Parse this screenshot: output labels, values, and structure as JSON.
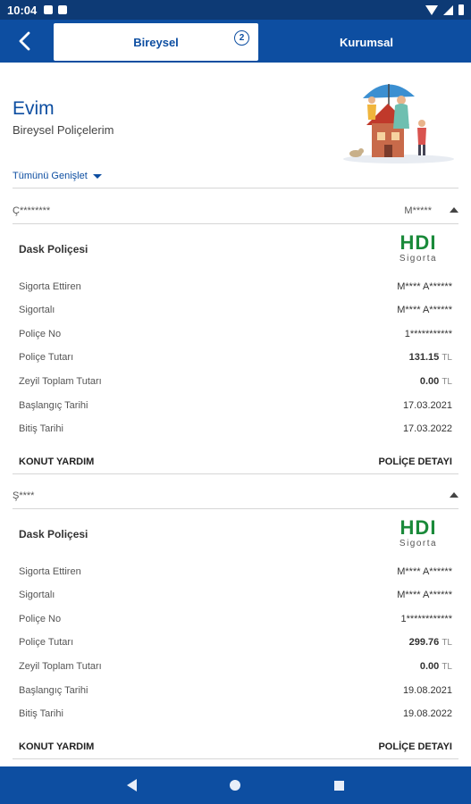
{
  "status_bar": {
    "time": "10:04"
  },
  "tabs": [
    {
      "label": "Bireysel",
      "badge": "2"
    },
    {
      "label": "Kurumsal"
    }
  ],
  "page": {
    "title": "Evim",
    "subtitle": "Bireysel Poliçelerim",
    "expand_all": "Tümünü Genişlet"
  },
  "groups": [
    {
      "name": "Ç********",
      "owner": "M*****",
      "policy": {
        "title": "Dask Poliçesi",
        "logo": {
          "brand": "HDI",
          "sub": "Sigorta"
        },
        "fields": [
          {
            "label": "Sigorta Ettiren",
            "value": "M**** A******"
          },
          {
            "label": "Sigortalı",
            "value": "M**** A******"
          },
          {
            "label": "Poliçe No",
            "value": "1***********"
          },
          {
            "label": "Poliçe Tutarı",
            "value": "131.15",
            "unit": "TL"
          },
          {
            "label": "Zeyil Toplam Tutarı",
            "value": "0.00",
            "unit": "TL"
          },
          {
            "label": "Başlangıç Tarihi",
            "value": "17.03.2021"
          },
          {
            "label": "Bitiş Tarihi",
            "value": "17.03.2022"
          }
        ],
        "footer_left": "KONUT YARDIM",
        "footer_right": "POLİÇE DETAYI"
      }
    },
    {
      "name": "Ş****",
      "owner": "",
      "policy": {
        "title": "Dask Poliçesi",
        "logo": {
          "brand": "HDI",
          "sub": "Sigorta"
        },
        "fields": [
          {
            "label": "Sigorta Ettiren",
            "value": "M**** A******"
          },
          {
            "label": "Sigortalı",
            "value": "M**** A******"
          },
          {
            "label": "Poliçe No",
            "value": "1************"
          },
          {
            "label": "Poliçe Tutarı",
            "value": "299.76",
            "unit": "TL"
          },
          {
            "label": "Zeyil Toplam Tutarı",
            "value": "0.00",
            "unit": "TL"
          },
          {
            "label": "Başlangıç Tarihi",
            "value": "19.08.2021"
          },
          {
            "label": "Bitiş Tarihi",
            "value": "19.08.2022"
          }
        ],
        "footer_left": "KONUT YARDIM",
        "footer_right": "POLİÇE DETAYI"
      }
    }
  ],
  "colors": {
    "primary": "#0d4ea1",
    "status_bar": "#0d3a75",
    "hdi_green": "#1a8a3a",
    "hdi_red": "#d41f26"
  },
  "icons": [
    "back-arrow-icon",
    "info-badge-icon",
    "caret-down-icon",
    "caret-up-icon",
    "nav-back-icon",
    "nav-home-icon",
    "nav-recents-icon"
  ]
}
